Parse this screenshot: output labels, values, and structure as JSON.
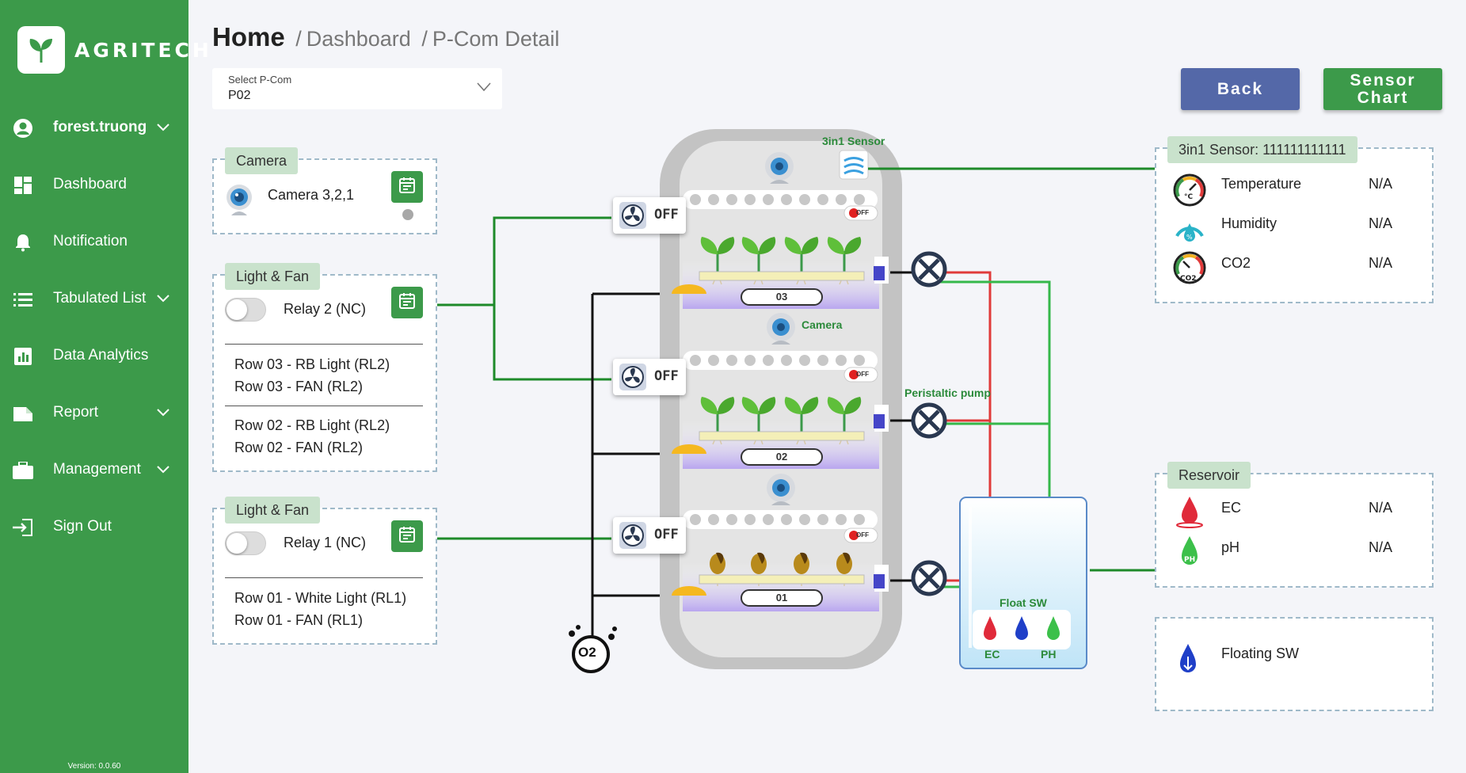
{
  "app": {
    "name": "AGRITECH",
    "version": "Version: 0.0.60"
  },
  "sidebar": {
    "user": "forest.truong",
    "items": [
      {
        "label": "Dashboard"
      },
      {
        "label": "Notification"
      },
      {
        "label": "Tabulated List"
      },
      {
        "label": "Data Analytics"
      },
      {
        "label": "Report"
      },
      {
        "label": "Management"
      },
      {
        "label": "Sign Out"
      }
    ]
  },
  "header": {
    "home": "Home",
    "sep1": "/",
    "crumb1": "Dashboard",
    "sep2": "/",
    "crumb2": "P-Com Detail"
  },
  "select": {
    "label": "Select P-Com",
    "value": "P02"
  },
  "buttons": {
    "back": "Back",
    "sensor_chart": "Sensor Chart"
  },
  "camera_panel": {
    "tag": "Camera",
    "name": "Camera 3,2,1"
  },
  "relay2_panel": {
    "tag": "Light & Fan",
    "relay": "Relay 2 (NC)",
    "rows": [
      "Row 03 - RB Light (RL2)",
      "Row 03 - FAN (RL2)",
      "Row 02 - RB Light (RL2)",
      "Row 02 - FAN (RL2)"
    ]
  },
  "relay1_panel": {
    "tag": "Light & Fan",
    "relay": "Relay 1 (NC)",
    "rows": [
      "Row 01 - White Light (RL1)",
      "Row 01 - FAN (RL1)"
    ]
  },
  "sensor_panel": {
    "tag": "3in1 Sensor: 111111111111",
    "rows": [
      {
        "label": "Temperature",
        "value": "N/A"
      },
      {
        "label": "Humidity",
        "value": "N/A"
      },
      {
        "label": "CO2",
        "value": "N/A"
      }
    ]
  },
  "reservoir_panel": {
    "tag": "Reservoir",
    "rows": [
      {
        "label": "EC",
        "value": "N/A"
      },
      {
        "label": "pH",
        "value": "N/A"
      }
    ]
  },
  "floating_panel": {
    "label": "Floating SW"
  },
  "diagram": {
    "sensor_label": "3in1 Sensor",
    "camera_label": "Camera",
    "pump_label": "Peristaltic pump",
    "float_label": "Float SW",
    "ec_label": "EC",
    "ph_label": "PH",
    "fan_state": "OFF",
    "mini_state": "OFF",
    "rows": [
      "03",
      "02",
      "01"
    ],
    "o2": "O2"
  },
  "colors": {
    "brand": "#3c9a4a",
    "back_button": "#5468a8",
    "line_green": "#1e8a2a",
    "line_red": "#e03a3a"
  }
}
